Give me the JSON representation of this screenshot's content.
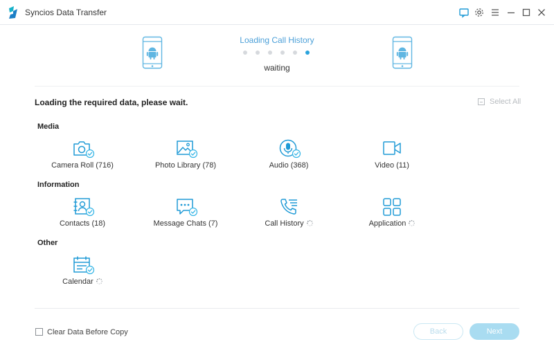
{
  "window": {
    "title": "Syncios Data Transfer"
  },
  "colors": {
    "accent": "#2aa3dc",
    "icon": "#1f9ad6",
    "check": "#32b4e6",
    "muted": "#b8bcc0",
    "button_light": "#a9dcf1"
  },
  "transfer": {
    "status_title": "Loading Call History",
    "status_sub": "waiting",
    "progress_steps": 6,
    "active_step": 6,
    "source_device_icon": "android-phone-icon",
    "target_device_icon": "android-phone-icon"
  },
  "content": {
    "heading": "Loading the required data, please wait.",
    "select_all": "Select All",
    "groups": [
      {
        "label": "Media"
      },
      {
        "label": "Information"
      },
      {
        "label": "Other"
      }
    ],
    "items": [
      {
        "label": "Camera Roll (716)",
        "icon": "camera-icon",
        "loading": false
      },
      {
        "label": "Photo Library (78)",
        "icon": "photo-icon",
        "loading": false
      },
      {
        "label": "Audio (368)",
        "icon": "microphone-icon",
        "loading": false
      },
      {
        "label": "Video (11)",
        "icon": "video-camera-icon",
        "loading": false
      },
      {
        "label": "Contacts (18)",
        "icon": "contacts-icon",
        "loading": false
      },
      {
        "label": "Message Chats (7)",
        "icon": "chat-icon",
        "loading": false
      },
      {
        "label": "Call History",
        "icon": "call-history-icon",
        "loading": true
      },
      {
        "label": "Application",
        "icon": "apps-grid-icon",
        "loading": true
      },
      {
        "label": "Calendar",
        "icon": "calendar-icon",
        "loading": true
      }
    ]
  },
  "footer": {
    "clear_label": "Clear Data Before Copy",
    "back_label": "Back",
    "next_label": "Next"
  }
}
